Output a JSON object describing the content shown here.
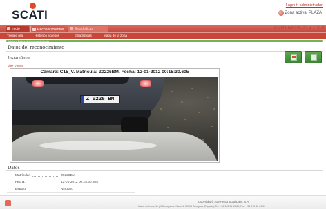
{
  "header": {
    "logo_text": "SCATI",
    "logout_label": "Logout: administrador",
    "zone_label": "Zona activa: PLAZA",
    "brand": "SURFERPLATE - 4.0"
  },
  "nav": {
    "tabs": [
      {
        "label": "Inicio"
      },
      {
        "label": "Reconocimientos"
      },
      {
        "label": "Estadísticas"
      }
    ],
    "subitems": [
      {
        "label": "Tiempo real"
      },
      {
        "label": "Histórico accesos"
      },
      {
        "label": "Estadísticas"
      },
      {
        "label": "Mapa de la zona"
      }
    ]
  },
  "breadcrumb": "Inicio > Datos del reconocimiento",
  "section_title": "Datos del reconocimiento",
  "instant_label": "Instantánea",
  "video_link": "Ver vídeo",
  "image_caption": "Cámara: C15_V. Matrícula: Z0225BM. Fecha: 12-01-2012 00:15:30.605",
  "plate_text": "Z 0225 BM",
  "datos": {
    "title": "Datos",
    "fields": [
      {
        "label": "Matrícula:",
        "value": "Z0225BM"
      },
      {
        "label": "Fecha:",
        "value": "12-01-2012 00:15:30.605"
      },
      {
        "label": "Estado:",
        "value": "Ninguno"
      }
    ]
  },
  "footer": {
    "copyright": "Copyright © 2009-2012 Scati Labs, S.A.",
    "address": "María de Luna, 11 (Edificiogaleón Nave 4) 50018 Zaragoza (España); Tel. +34 902 11 60 80; Fax: +34 976 46 69 09"
  },
  "colors": {
    "accent": "#c8473a",
    "success": "#6fb35a",
    "link": "#c0322a"
  }
}
